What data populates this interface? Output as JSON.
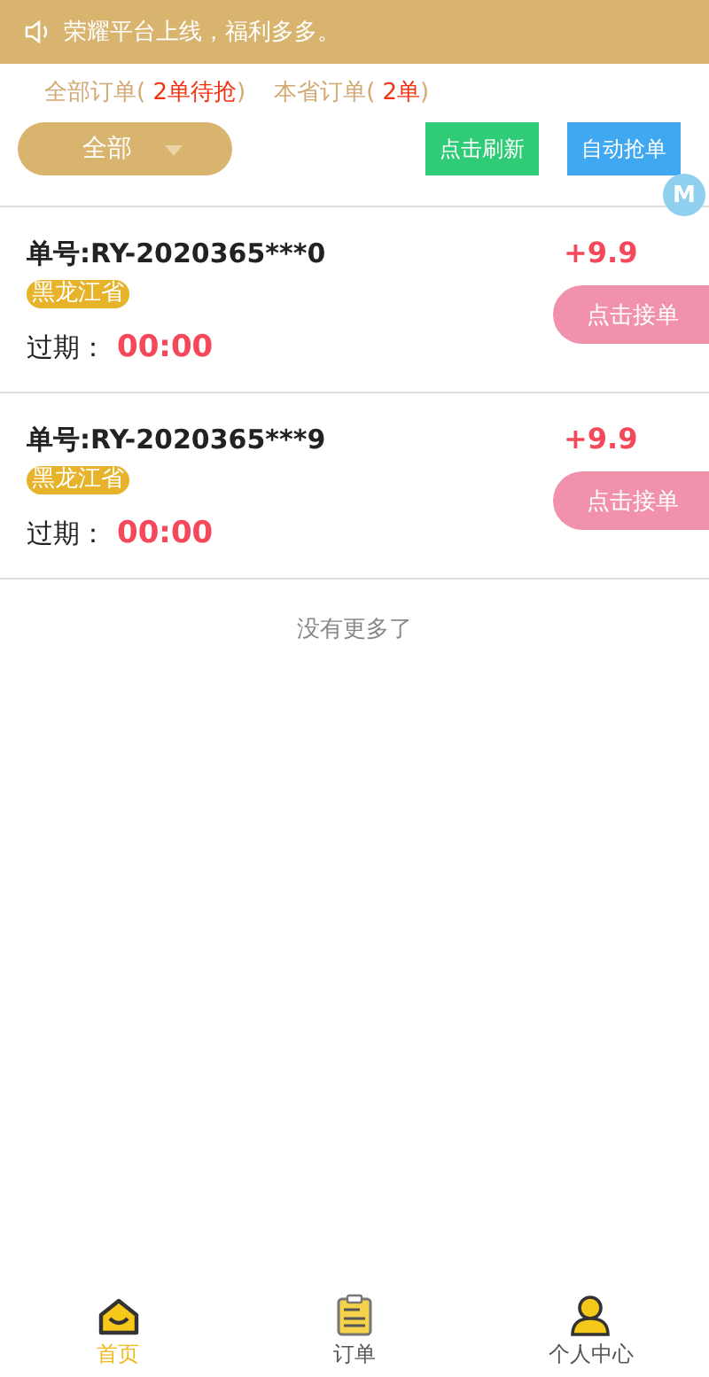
{
  "notice": {
    "text": "荣耀平台上线，福利多多。"
  },
  "counts": [
    {
      "label": "全部订单(",
      "count": " 2单待抢",
      "close": ")"
    },
    {
      "label": "本省订单(",
      "count": " 2单",
      "close": ")"
    }
  ],
  "filter": {
    "value": "全部"
  },
  "actions": [
    {
      "label": "点击刷新",
      "kind": "refresh"
    },
    {
      "label": "自动抢单",
      "kind": "auto"
    }
  ],
  "floating_badge": "M",
  "orders": [
    {
      "number": "单号:RY-2020365***0",
      "amount": "+9.9",
      "province": "黑龙江省",
      "expiry_label": "过期：",
      "expiry": "00:00",
      "button": "点击接单"
    },
    {
      "number": "单号:RY-2020365***9",
      "amount": "+9.9",
      "province": "黑龙江省",
      "expiry_label": "过期：",
      "expiry": "00:00",
      "button": "点击接单"
    }
  ],
  "end_text": "没有更多了",
  "tabbar": [
    {
      "label": "首页",
      "kind": "home",
      "selected": true
    },
    {
      "label": "订单",
      "kind": "orders",
      "selected": false
    },
    {
      "label": "个人中心",
      "kind": "profile",
      "selected": false
    }
  ]
}
